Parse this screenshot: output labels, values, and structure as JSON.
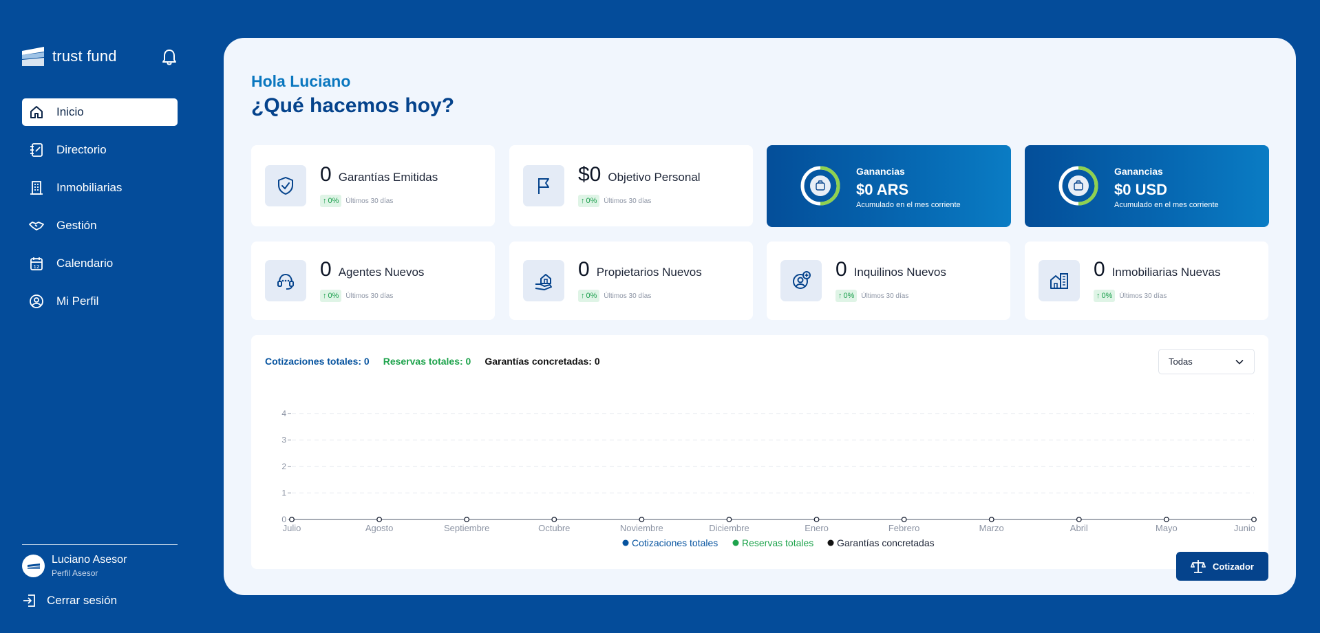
{
  "app": {
    "brand": "trust fund"
  },
  "sidebar": {
    "items": [
      {
        "label": "Inicio",
        "icon": "home-icon"
      },
      {
        "label": "Directorio",
        "icon": "notebook-icon"
      },
      {
        "label": "Inmobiliarias",
        "icon": "building-icon"
      },
      {
        "label": "Gestión",
        "icon": "handshake-icon"
      },
      {
        "label": "Calendario",
        "icon": "calendar-icon"
      },
      {
        "label": "Mi Perfil",
        "icon": "user-circle-icon"
      }
    ],
    "active": "Inicio",
    "user": {
      "name": "Luciano Asesor",
      "role": "Perfil Asesor"
    },
    "logout": "Cerrar sesión"
  },
  "header": {
    "greeting": "Hola Luciano",
    "headline": "¿Qué hacemos hoy?"
  },
  "stats": [
    {
      "value": "0",
      "label": "Garantías Emitidas",
      "change": "0%",
      "period": "Últimos 30 días",
      "icon": "shield-check-icon"
    },
    {
      "value": "$0",
      "label": "Objetivo Personal",
      "change": "0%",
      "period": "Últimos 30 días",
      "icon": "flag-icon"
    },
    {
      "value": "0",
      "label": "Agentes Nuevos",
      "change": "0%",
      "period": "Últimos 30 días",
      "icon": "headset-icon"
    },
    {
      "value": "0",
      "label": "Propietarios Nuevos",
      "change": "0%",
      "period": "Últimos 30 días",
      "icon": "house-hand-icon"
    },
    {
      "value": "0",
      "label": "Inquilinos Nuevos",
      "change": "0%",
      "period": "Últimos 30 días",
      "icon": "user-plus-icon"
    },
    {
      "value": "0",
      "label": "Inmobiliarias Nuevas",
      "change": "0%",
      "period": "Últimos 30 días",
      "icon": "buildings-icon"
    }
  ],
  "earnings": [
    {
      "title": "Ganancias",
      "value": "$0 ARS",
      "subtitle": "Acumulado en el mes corriente",
      "icon": "money-bag-icon"
    },
    {
      "title": "Ganancias",
      "value": "$0 USD",
      "subtitle": "Acumulado en el mes corriente",
      "icon": "money-bag-icon"
    }
  ],
  "chart_panel": {
    "totals": {
      "cotizaciones": "Cotizaciones totales: 0",
      "reservas": "Reservas totales: 0",
      "garantias": "Garantías concretadas: 0"
    },
    "filter": {
      "selected": "Todas"
    }
  },
  "colors": {
    "background": "#044c9a",
    "cotizaciones": "#06539f",
    "reservas": "#1ea34c",
    "garantias": "#121212"
  },
  "chart_data": {
    "type": "line",
    "x": [
      "Julio",
      "Agosto",
      "Septiembre",
      "Octubre",
      "Noviembre",
      "Diciembre",
      "Enero",
      "Febrero",
      "Marzo",
      "Abril",
      "Mayo",
      "Junio"
    ],
    "yticks": [
      "0",
      "1",
      "2",
      "3",
      "4"
    ],
    "ylim": [
      0,
      4
    ],
    "grid": true,
    "legend_position": "bottom",
    "series": [
      {
        "name": "Cotizaciones totales",
        "values": [
          0,
          0,
          0,
          0,
          0,
          0,
          0,
          0,
          0,
          0,
          0,
          0
        ]
      },
      {
        "name": "Reservas totales",
        "values": [
          0,
          0,
          0,
          0,
          0,
          0,
          0,
          0,
          0,
          0,
          0,
          0
        ]
      },
      {
        "name": "Garantías concretadas",
        "values": [
          0,
          0,
          0,
          0,
          0,
          0,
          0,
          0,
          0,
          0,
          0,
          0
        ]
      }
    ]
  },
  "actions": {
    "cotizador": "Cotizador"
  }
}
